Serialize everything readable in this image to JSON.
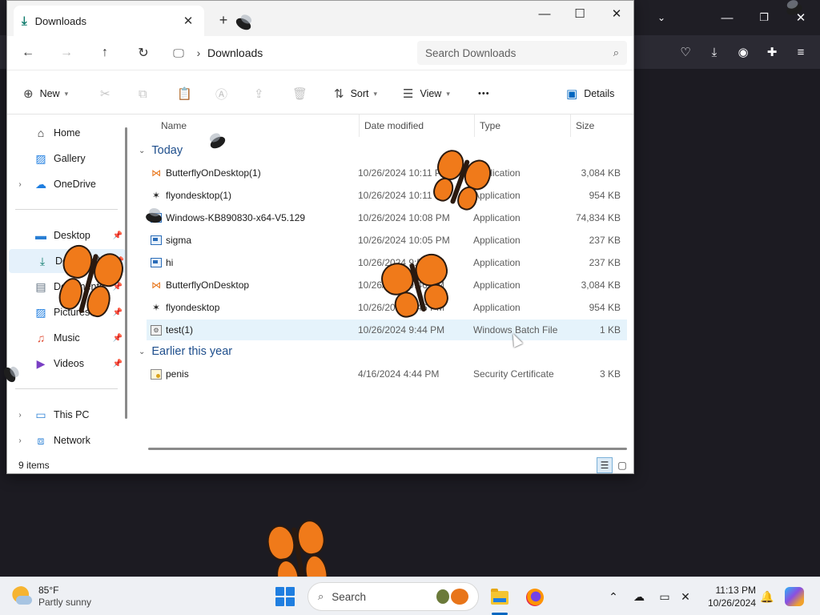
{
  "explorer": {
    "tab_title": "Downloads",
    "tab_close": "✕",
    "new_tab": "+",
    "window_controls": {
      "minimize": "—",
      "maximize": "☐",
      "close": "✕"
    },
    "nav": {
      "back": "←",
      "forward": "→",
      "up": "↑",
      "refresh": "↻"
    },
    "address": {
      "separator": "›",
      "crumb": "Downloads"
    },
    "search": {
      "placeholder": "Search Downloads"
    },
    "commands": {
      "new": "New",
      "sort": "Sort",
      "view": "View",
      "more": "•••",
      "details": "Details"
    },
    "sidebar": {
      "items": [
        {
          "label": "Home",
          "icon": "home-icon"
        },
        {
          "label": "Gallery",
          "icon": "gallery-icon"
        },
        {
          "label": "OneDrive",
          "icon": "cloud-icon"
        },
        {
          "label": "Desktop",
          "icon": "desktop-icon"
        },
        {
          "label": "Downloads",
          "icon": "download-icon"
        },
        {
          "label": "Documents",
          "icon": "document-icon"
        },
        {
          "label": "Pictures",
          "icon": "picture-icon"
        },
        {
          "label": "Music",
          "icon": "music-icon"
        },
        {
          "label": "Videos",
          "icon": "video-icon"
        },
        {
          "label": "This PC",
          "icon": "pc-icon"
        },
        {
          "label": "Network",
          "icon": "network-icon"
        }
      ]
    },
    "columns": {
      "name": "Name",
      "date": "Date modified",
      "type": "Type",
      "size": "Size"
    },
    "groups": {
      "today": "Today",
      "earlier": "Earlier this year"
    },
    "files_today": [
      {
        "name": "ButterflyOnDesktop(1)",
        "date": "10/26/2024 10:11 PM",
        "type": "Application",
        "size": "3,084 KB",
        "icon": "butterfly-icon"
      },
      {
        "name": "flyondesktop(1)",
        "date": "10/26/2024 10:11 PM",
        "type": "Application",
        "size": "954 KB",
        "icon": "fly-icon"
      },
      {
        "name": "Windows-KB890830-x64-V5.129",
        "date": "10/26/2024 10:08 PM",
        "type": "Application",
        "size": "74,834 KB",
        "icon": "app-icon"
      },
      {
        "name": "sigma",
        "date": "10/26/2024 10:05 PM",
        "type": "Application",
        "size": "237 KB",
        "icon": "app-icon"
      },
      {
        "name": "hi",
        "date": "10/26/2024 9:52 PM",
        "type": "Application",
        "size": "237 KB",
        "icon": "app-icon"
      },
      {
        "name": "ButterflyOnDesktop",
        "date": "10/26/2024 9:46 PM",
        "type": "Application",
        "size": "3,084 KB",
        "icon": "butterfly-icon"
      },
      {
        "name": "flyondesktop",
        "date": "10/26/2024 9:46 PM",
        "type": "Application",
        "size": "954 KB",
        "icon": "fly-icon"
      },
      {
        "name": "test(1)",
        "date": "10/26/2024 9:44 PM",
        "type": "Windows Batch File",
        "size": "1 KB",
        "icon": "batch-file-icon"
      }
    ],
    "files_earlier": [
      {
        "name": "penis",
        "date": "4/16/2024 4:44 PM",
        "type": "Security Certificate",
        "size": "3 KB",
        "icon": "certificate-icon"
      }
    ],
    "status": {
      "count": "9 items"
    }
  },
  "taskbar": {
    "weather": {
      "temp": "85°F",
      "condition": "Partly sunny"
    },
    "search_label": "Search",
    "clock": {
      "time": "11:13 PM",
      "date": "10/26/2024"
    }
  },
  "colors": {
    "accent": "#0067c0",
    "group_header": "#1e4e8c",
    "selected_bg": "#e5f1fb",
    "hover_bg": "#e5f3fb",
    "browser_bg": "#1c1b22"
  }
}
